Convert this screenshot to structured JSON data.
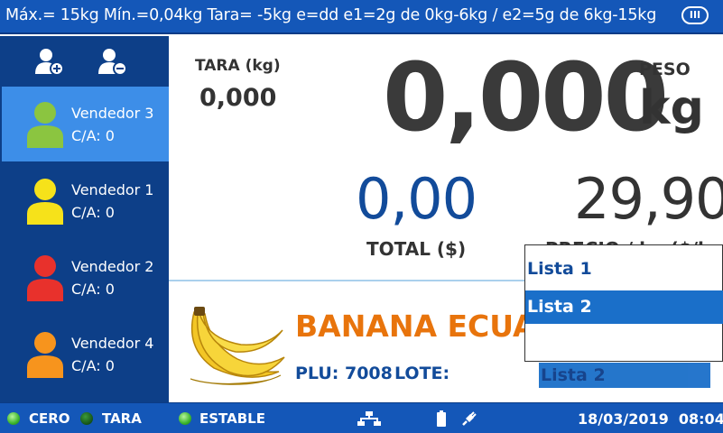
{
  "top_bar": {
    "spec_text": "Máx.= 15kg  Mín.=0,04kg  Tara= -5kg  e=dd  e1=2g de 0kg-6kg / e2=5g de 6kg-15kg",
    "class_badge": "III"
  },
  "sidebar": {
    "actions": [
      {
        "name": "add-user",
        "icon": "user-plus-icon"
      },
      {
        "name": "remove-user",
        "icon": "user-minus-icon"
      }
    ],
    "vendors": [
      {
        "name": "Vendedor 3",
        "ca": "C/A: 0",
        "color": "#8bc540",
        "selected": true
      },
      {
        "name": "Vendedor 1",
        "ca": "C/A: 0",
        "color": "#f6e21a",
        "selected": false
      },
      {
        "name": "Vendedor 2",
        "ca": "C/A: 0",
        "color": "#e8312c",
        "selected": false
      },
      {
        "name": "Vendedor 4",
        "ca": "C/A: 0",
        "color": "#f7941d",
        "selected": false
      }
    ]
  },
  "scale": {
    "tara_label": "TARA (kg)",
    "tara_value": "0,000",
    "weight_value": "0,000",
    "peso_label": "PESO",
    "unit": "kg",
    "total_value": "0,00",
    "total_label": "TOTAL ($)",
    "price_value": "29,90",
    "price_label": "PRECIO / kg ($/kg)"
  },
  "product": {
    "name": "BANANA ECUADOR",
    "plu_label": "PLU: 7008",
    "lote_label": "LOTE:",
    "price_list_value": "Lista 2",
    "image_icon": "banana-image"
  },
  "dropdown": {
    "options": [
      "Lista 1",
      "Lista 2",
      ""
    ],
    "selected": "Lista 2"
  },
  "status_bar": {
    "cero_label": "CERO",
    "cero_on": true,
    "tara_label": "TARA",
    "tara_on": false,
    "estable_label": "ESTABLE",
    "estable_on": true,
    "network_icon": "network-icon",
    "battery_icon": "battery-icon",
    "power_icon": "plug-icon",
    "date": "18/03/2019",
    "time": "08:04"
  },
  "colors": {
    "bar_blue": "#1457b8",
    "sidebar_blue": "#0d3f88",
    "selected_blue": "#3d8ee8",
    "product_orange": "#e8740c",
    "total_blue": "#124b9a"
  }
}
